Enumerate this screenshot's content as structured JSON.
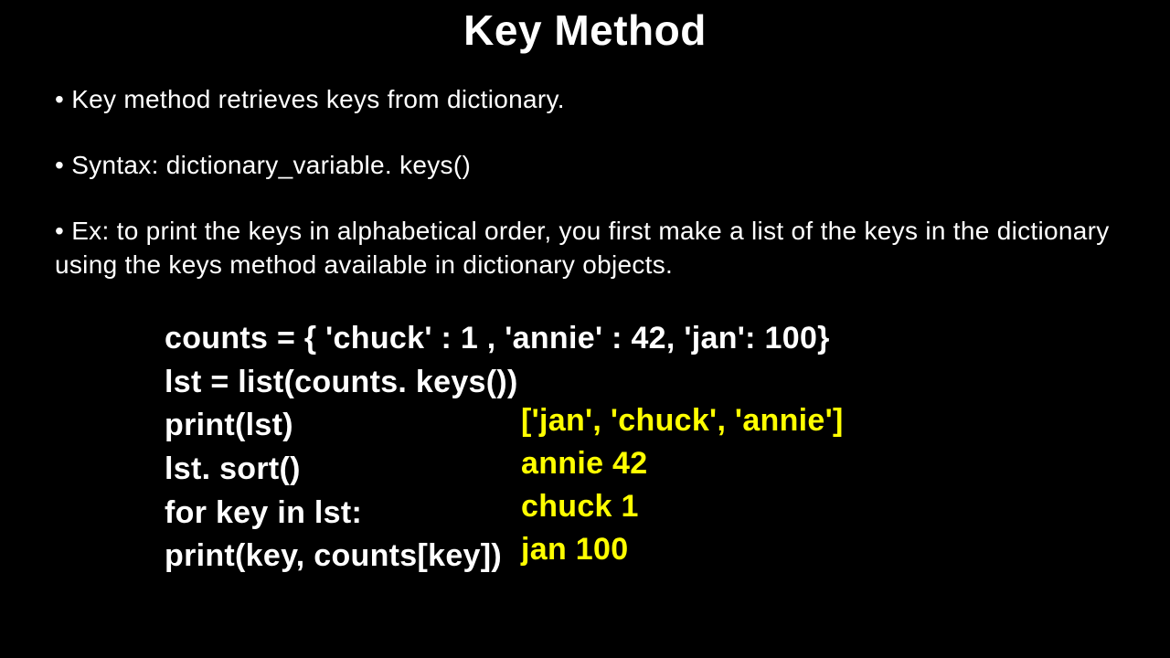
{
  "title": "Key Method",
  "bullets": {
    "b1": "Key method retrieves keys from dictionary.",
    "b2": "Syntax: dictionary_variable. keys()",
    "b3": "Ex: to print the keys in alphabetical order, you first make a list of the keys in the dictionary using the keys method available in dictionary objects."
  },
  "code": {
    "l1": "counts = { 'chuck' : 1 , 'annie' : 42, 'jan': 100}",
    "l2": "lst = list(counts. keys())",
    "l3": "print(lst)",
    "l4": "lst. sort()",
    "l5": "for key in lst:",
    "l6": "print(key, counts[key])"
  },
  "output": {
    "o1": "['jan', 'chuck', 'annie']",
    "o2": "annie 42",
    "o3": "chuck 1",
    "o4": "jan 100"
  }
}
